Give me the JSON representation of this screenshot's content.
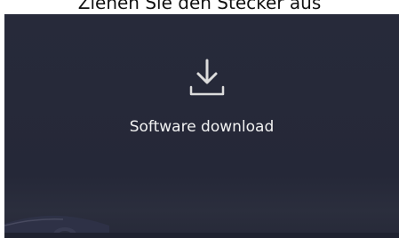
{
  "caption": "Ziehen Sie den Stecker aus",
  "screen": {
    "icon": "download-icon",
    "status_text": "Software download",
    "colors": {
      "background": "#272a3a",
      "icon": "#dcdcdc",
      "text": "#f2f2f2"
    }
  }
}
